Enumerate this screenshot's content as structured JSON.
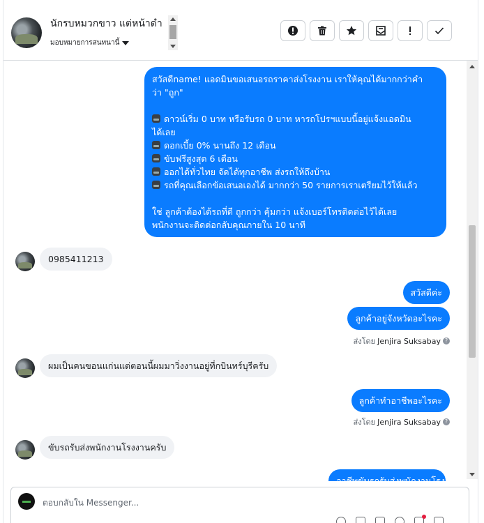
{
  "header": {
    "contact_name": "นักรบหมวกขาว แต่หน้าดำ",
    "assign_label": "มอบหมายการสนทนานี้",
    "actions": [
      {
        "icon": "alert-circle-icon"
      },
      {
        "icon": "trash-icon"
      },
      {
        "icon": "star-icon"
      },
      {
        "icon": "mark-unread-icon"
      },
      {
        "icon": "exclamation-icon"
      },
      {
        "icon": "check-icon"
      }
    ]
  },
  "messages": {
    "promo_lines": [
      "สวัสดีname! แอดมินขอเสนอรถราคาส่งโรงงาน เราให้คุณได้มากกว่าคำ",
      "ว่า \"ถูก\"",
      "",
      "ดาวน์เริ่ม 0 บาท หรือรับรถ 0 บาท หารถโปรฯแบบนี้อยู่แจ้งแอดมิน",
      "ได้เลย",
      "ดอกเบี้ย 0% นานถึง 12 เดือน",
      "ขับฟรีสูงสุด 6 เดือน",
      "ออกได้ทั่วไทย จัดได้ทุกอาชีพ ส่งรถให้ถึงบ้าน",
      "รถที่คุณเลือกข้อเสนอเองได้ มากกว่า 50 รายการเราเตรียมไว้ให้แล้ว",
      "",
      "ใช่ ลูกค้าต้องได้รถที่ดี ถูกกว่า คุ้มกว่า แจ้งเบอร์โทรติดต่อไว้ได้เลย",
      "พนักงานจะติดต่อกลับคุณภายใน 10 นาที"
    ],
    "phone": "0985411213",
    "greet": "สวัสดีค่ะ",
    "ask_province": "ลูกค้าอยู่จังหวัดอะไรคะ",
    "sent_by_label": "ส่งโดย",
    "agent_name": "Jenjira Suksabay",
    "reply_province": "ผมเป็นคนขอนแก่นแต่ตอนนี้ผมมาวิ่งงานอยู่ที่กบินทร์บุรีครับ",
    "ask_job": "ลูกค้าทำอาชีพอะไรคะ",
    "reply_job": "ขับรถรับส่งพนักงานโรงงานครับ",
    "next_partial": "อาชีพขับรถรับส่งพนักงานโรง"
  },
  "composer": {
    "placeholder": "ตอบกลับใน Messenger..."
  },
  "colors": {
    "outgoing_bubble": "#0a7cff",
    "incoming_bubble": "#f0f2f5"
  }
}
